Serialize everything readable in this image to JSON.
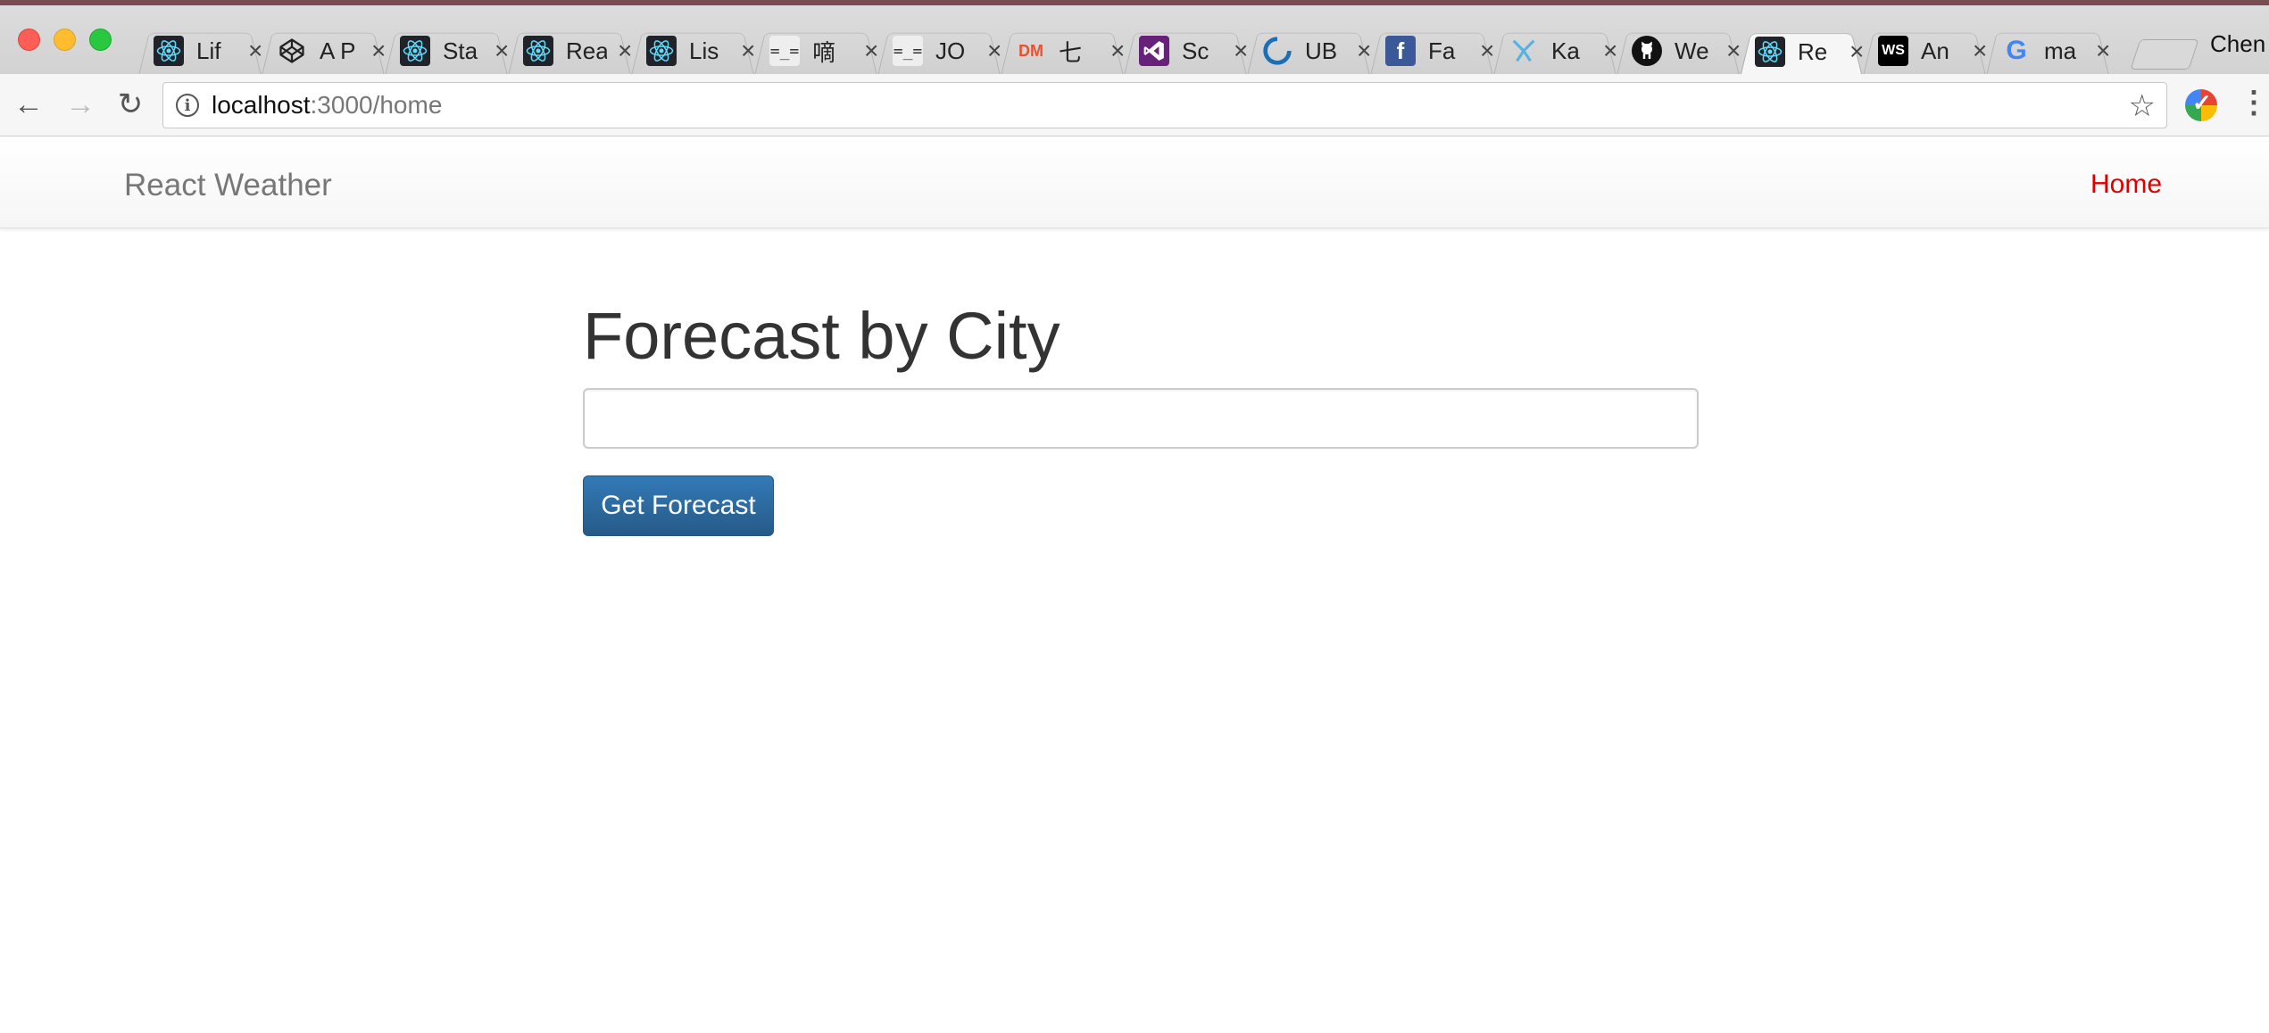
{
  "browser": {
    "tabs": [
      {
        "title": "Lif",
        "favicon": "react-icon"
      },
      {
        "title": "A P",
        "favicon": "codepen-icon"
      },
      {
        "title": "Sta",
        "favicon": "react-icon"
      },
      {
        "title": "Rea",
        "favicon": "react-icon"
      },
      {
        "title": "Lis",
        "favicon": "react-icon"
      },
      {
        "title": "嘀",
        "favicon": "face-icon"
      },
      {
        "title": "JO",
        "favicon": "face-icon"
      },
      {
        "title": "七",
        "favicon": "dm-icon"
      },
      {
        "title": "Sc",
        "favicon": "visual-studio-icon"
      },
      {
        "title": "UB",
        "favicon": "ubi-icon"
      },
      {
        "title": "Fa",
        "favicon": "facebook-icon"
      },
      {
        "title": "Ka",
        "favicon": "karma-icon"
      },
      {
        "title": "We",
        "favicon": "github-icon"
      },
      {
        "title": "Re",
        "favicon": "react-icon",
        "active": true
      },
      {
        "title": "An",
        "favicon": "webstorm-icon"
      },
      {
        "title": "ma",
        "favicon": "google-icon"
      }
    ],
    "profile_name": "Chen",
    "url_host": "localhost",
    "url_path": ":3000/home"
  },
  "navbar": {
    "brand": "React Weather",
    "links": [
      {
        "label": "Home",
        "active": true
      }
    ]
  },
  "main": {
    "title": "Forecast by City",
    "city_input": {
      "value": "",
      "placeholder": ""
    },
    "submit_label": "Get Forecast"
  },
  "colors": {
    "nav_active": "#dd0000",
    "button_primary": "#2d6ca2",
    "text": "#333333"
  }
}
